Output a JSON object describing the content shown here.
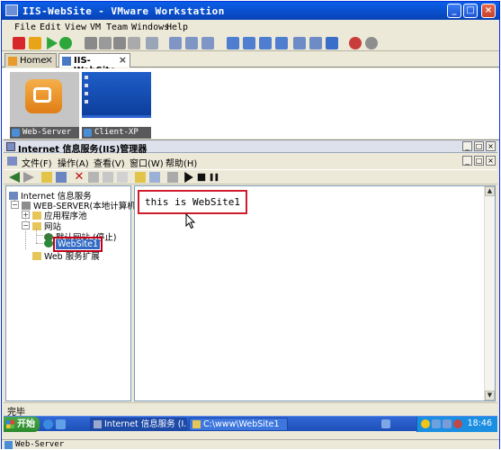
{
  "vmware": {
    "title": "IIS-WebSite - VMware Workstation",
    "menu": [
      "File",
      "Edit",
      "View",
      "VM",
      "Team",
      "Windows",
      "Help"
    ],
    "tabs": [
      {
        "label": "Home",
        "icon": "home-icon"
      },
      {
        "label": "IIS-WebSite",
        "icon": "vm-team-icon",
        "active": true
      }
    ],
    "thumbnails": [
      {
        "label": "Web-Server",
        "selected": true
      },
      {
        "label": "Client-XP",
        "selected": false
      }
    ],
    "status_label": "Web-Server"
  },
  "mmc": {
    "title": "Internet 信息服务(IIS)管理器",
    "menu": [
      "文件(F)",
      "操作(A)",
      "查看(V)",
      "窗口(W)",
      "帮助(H)"
    ],
    "tree": {
      "root": "Internet 信息服务",
      "server": "WEB-SERVER(本地计算机)",
      "app_pools": "应用程序池",
      "sites": "网站",
      "default_site": "默认网站 (停止)",
      "website1": "WebSite1",
      "web_ext": "Web 服务扩展"
    },
    "content_text": "this is WebSite1",
    "status": "完毕"
  },
  "taskbar": {
    "start": "开始",
    "tasks": [
      {
        "label": "Internet 信息服务 (I...",
        "active": true
      },
      {
        "label": "C:\\www\\WebSite1",
        "active": false
      }
    ],
    "clock": "18:46"
  },
  "colors": {
    "xp_blue": "#0A5FE8",
    "highlight_red": "#d01d2e",
    "selection_blue": "#316AC5"
  }
}
